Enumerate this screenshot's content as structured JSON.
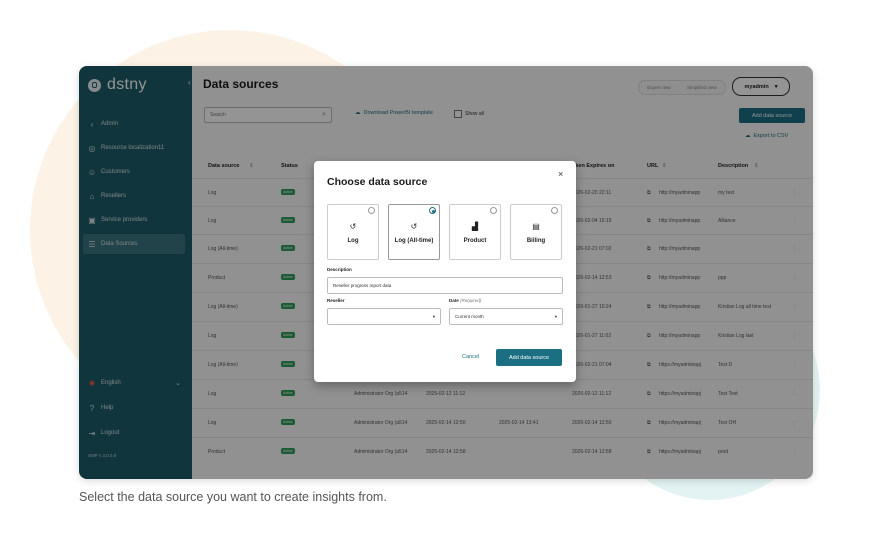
{
  "brand": {
    "name": "dstny"
  },
  "sidebar": {
    "items": [
      {
        "label": "Admin",
        "icon": "chevron-left-icon"
      },
      {
        "label": "Resource localization11",
        "icon": "globe-icon"
      },
      {
        "label": "Customers",
        "icon": "users-icon"
      },
      {
        "label": "Resellers",
        "icon": "store-icon"
      },
      {
        "label": "Service providers",
        "icon": "building-icon"
      },
      {
        "label": "Data Sources",
        "icon": "database-icon",
        "active": true
      }
    ],
    "footer": [
      {
        "label": "English",
        "icon": "globe-icon"
      },
      {
        "label": "Help",
        "icon": "help-icon"
      },
      {
        "label": "Logout",
        "icon": "logout-icon"
      }
    ],
    "version": "SMP v 3.0.0.8"
  },
  "header": {
    "title": "Data sources",
    "view_expert": "Expert view",
    "view_simplified": "Simplified view",
    "user": "myadmin"
  },
  "toolbar": {
    "search_placeholder": "Search",
    "download_template": "Download PowerBI template",
    "show_all": "Show all",
    "add_data_source": "Add data source",
    "export_csv": "Export to CSV"
  },
  "table": {
    "headers": {
      "data_source": "Data source",
      "status": "Status",
      "token_expires": "oken Expires on",
      "url": "URL",
      "description": "Description"
    },
    "rows": [
      {
        "source": "Log",
        "status": "Active",
        "owner": "",
        "created": "",
        "updated": "",
        "expires": "2026-02-20 22:11",
        "url": "http://myadminapp",
        "desc": "my test"
      },
      {
        "source": "Log",
        "status": "Active",
        "owner": "",
        "created": "",
        "updated": "",
        "expires": "2026-02-04 15:15",
        "url": "http://myadminapp",
        "desc": "Alliance"
      },
      {
        "source": "Log (All-time)",
        "status": "Active",
        "owner": "",
        "created": "",
        "updated": "",
        "expires": "2026-02-21 07:02",
        "url": "http://myadminapp",
        "desc": ""
      },
      {
        "source": "Product",
        "status": "Active",
        "owner": "",
        "created": "",
        "updated": "",
        "expires": "2026-02-14 12:53",
        "url": "http://myadminapp",
        "desc": "ppp"
      },
      {
        "source": "Log (All-time)",
        "status": "Active",
        "owner": "",
        "created": "",
        "updated": "",
        "expires": "2026-01-27 10:24",
        "url": "http://myadminapp",
        "desc": "Kristian Log all time test"
      },
      {
        "source": "Log",
        "status": "Active",
        "owner": "",
        "created": "",
        "updated": "",
        "expires": "2026-01-27 11:02",
        "url": "http://myadminapp",
        "desc": "Kristian Log last"
      },
      {
        "source": "Log (All-time)",
        "status": "Active",
        "owner": "",
        "created": "",
        "updated": "",
        "expires": "2026-02-21 07:04",
        "url": "https://myadminapj",
        "desc": "Test D"
      },
      {
        "source": "Log",
        "status": "Active",
        "owner": "Administrator Org (a514",
        "created": "2025-02-12 11:12",
        "updated": "",
        "expires": "2026-02-12 11:12",
        "url": "https://myadminapj",
        "desc": "Test Test"
      },
      {
        "source": "Log",
        "status": "Active",
        "owner": "Administrator Org (a514",
        "created": "2025-02-14 12:50",
        "updated": "2025-02-14 13:41",
        "expires": "2026-02-14 12:50",
        "url": "https://myadminapj",
        "desc": "Test OH"
      },
      {
        "source": "Product",
        "status": "Active",
        "owner": "Administrator Org (a514",
        "created": "2025-02-14 12:58",
        "updated": "",
        "expires": "2026-02-14 12:58",
        "url": "https://myadminapj",
        "desc": "prod"
      }
    ]
  },
  "modal": {
    "title": "Choose data source",
    "close": "×",
    "options": [
      {
        "label": "Log",
        "icon": "history-icon",
        "selected": false
      },
      {
        "label": "Log (All-time)",
        "icon": "history-icon",
        "selected": true
      },
      {
        "label": "Product",
        "icon": "product-icon",
        "selected": false
      },
      {
        "label": "Billing",
        "icon": "billing-icon",
        "selected": false
      }
    ],
    "description_label": "Description",
    "description_value": "Reseller progress report data",
    "reseller_label": "Reseller",
    "reseller_value": "",
    "date_label": "Date",
    "date_required": "(Required)",
    "date_value": "Current month",
    "cancel": "Cancel",
    "submit": "Add data source"
  },
  "caption": "Select the data source you want to create insights from.",
  "colors": {
    "primary": "#1c6f82",
    "sidebar": "#1c5c68",
    "active_badge": "#2f9b57"
  }
}
